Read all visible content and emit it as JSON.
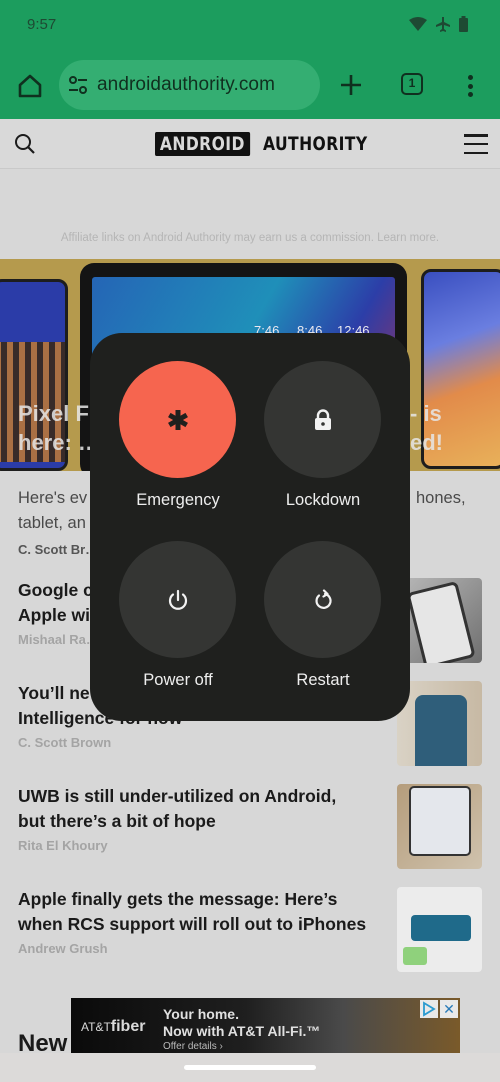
{
  "status_bar": {
    "time": "9:57",
    "icons": [
      "wifi-icon",
      "airplane-mode-icon",
      "battery-icon"
    ]
  },
  "browser": {
    "url": "androidauthority.com",
    "tab_count": "1",
    "icons": [
      "home-icon",
      "site-settings-icon",
      "new-tab-icon",
      "tab-switcher-icon",
      "more-options-icon"
    ]
  },
  "site": {
    "logo_box": "ANDROID",
    "logo_text": "AUTHORITY",
    "affiliate_notice": "Affiliate links on Android Authority may earn us a commission. Learn more."
  },
  "hero": {
    "title_left_line1": "Pixel F",
    "title_left_line2": "here: …",
    "title_right_line1": "- is",
    "title_right_line2": "ed!",
    "tablet_clocks": [
      "7:46",
      "8:46",
      "12:46"
    ],
    "excerpt": "Here's ev… phones, tablet, an…",
    "excerpt_line1_left": "Here's ev",
    "excerpt_line1_right": "hones,",
    "excerpt_line2_left": "tablet, an",
    "author": "C. Scott Br…"
  },
  "articles": [
    {
      "headline_line1": "Google c…",
      "headline_line2": "Apple wi…",
      "author": "Mishaal Ra…"
    },
    {
      "headline_line1": "You’ll ne…",
      "headline_line2": "Intelligence for now",
      "author": "C. Scott Brown"
    },
    {
      "headline_line1": "UWB is still under-utilized on Android,",
      "headline_line2": "but there’s a bit of hope",
      "author": "Rita El Khoury"
    },
    {
      "headline_line1": "Apple finally gets the message: Here’s",
      "headline_line2": "when RCS support will roll out to iPhones",
      "author": "Andrew Grush"
    }
  ],
  "section_heading": "New",
  "ad": {
    "brand_small": "AT&T",
    "brand_big": "fiber",
    "line1": "Your home.",
    "line2": "Now with AT&T All-Fi.™",
    "line3": "Offer details ›",
    "close": "✕"
  },
  "power_menu": {
    "items": [
      {
        "label": "Emergency",
        "icon": "emergency-asterisk-icon",
        "color": "#f6654f"
      },
      {
        "label": "Lockdown",
        "icon": "lock-icon",
        "color": "#343533"
      },
      {
        "label": "Power off",
        "icon": "power-icon",
        "color": "#343533"
      },
      {
        "label": "Restart",
        "icon": "restart-icon",
        "color": "#343533"
      }
    ]
  },
  "colors": {
    "toolbar_green": "#1c9d5e",
    "emergency": "#f6654f",
    "menu_bg": "#1f201e",
    "button_bg": "#343533"
  }
}
